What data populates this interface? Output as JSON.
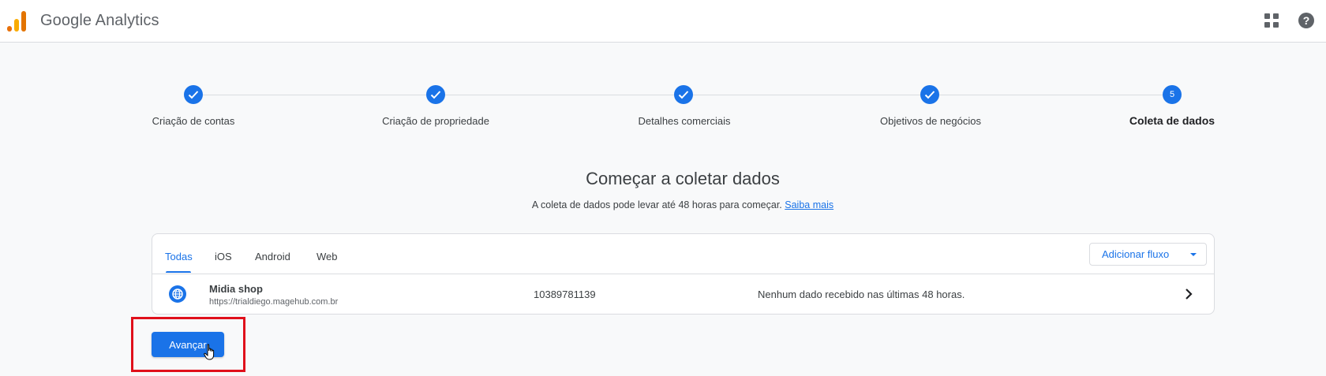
{
  "app": {
    "title": "Google Analytics",
    "icons": [
      "analytics-logo-icon",
      "apps-grid-icon",
      "help-icon"
    ]
  },
  "stepper": {
    "steps": [
      {
        "label": "Criação de contas",
        "state": "completed"
      },
      {
        "label": "Criação de propriedade",
        "state": "completed"
      },
      {
        "label": "Detalhes comerciais",
        "state": "completed"
      },
      {
        "label": "Objetivos de negócios",
        "state": "completed"
      },
      {
        "label": "Coleta de dados",
        "state": "active",
        "number": "5"
      }
    ]
  },
  "main": {
    "heading": "Começar a coletar dados",
    "subtext": "A coleta de dados pode levar até 48 horas para começar.",
    "learn_more": "Saiba mais"
  },
  "streams": {
    "tabs": [
      {
        "label": "Todas",
        "selected": true
      },
      {
        "label": "iOS",
        "selected": false
      },
      {
        "label": "Android",
        "selected": false
      },
      {
        "label": "Web",
        "selected": false
      }
    ],
    "add_button": "Adicionar fluxo",
    "rows": [
      {
        "icon": "globe-icon",
        "name": "Midia shop",
        "url": "https://trialdiego.magehub.com.br",
        "id": "10389781139",
        "status": "Nenhum dado recebido nas últimas 48 horas."
      }
    ]
  },
  "footer": {
    "next_button": "Avançar"
  },
  "colors": {
    "primary": "#1a73e8",
    "highlight": "#e0101b",
    "logo_orange": "#e37400",
    "logo_yellow": "#f9ab00"
  }
}
